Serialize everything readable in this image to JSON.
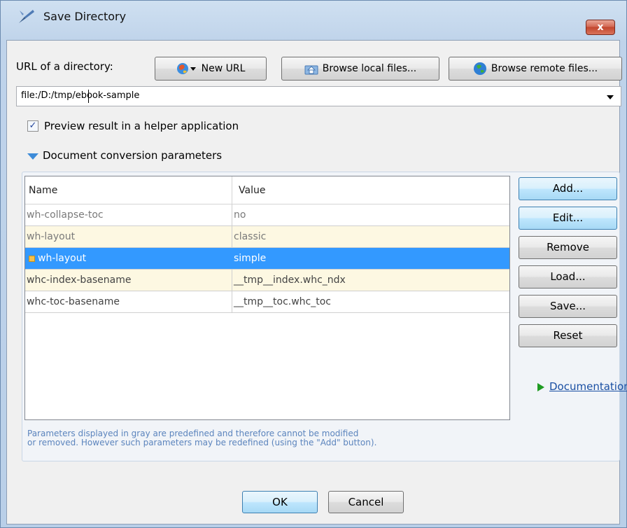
{
  "window": {
    "title": "Save Directory",
    "close_label": "x"
  },
  "url_section": {
    "label": "URL of a directory:",
    "new_url_label": "New URL",
    "browse_local_label": "Browse local files...",
    "browse_remote_label": "Browse remote files...",
    "url_value": "file:/D:/tmp/ebook-sample"
  },
  "preview": {
    "label": "Preview result in a helper application",
    "checked": true,
    "check_glyph": "✓"
  },
  "params_section": {
    "label": "Document conversion parameters",
    "columns": [
      "Name",
      "Value"
    ],
    "rows": [
      {
        "name": "wh-collapse-toc",
        "value": "no"
      },
      {
        "name": "wh-layout",
        "value": "classic"
      },
      {
        "name": "wh-layout",
        "value": "simple"
      },
      {
        "name": "whc-index-basename",
        "value": "__tmp__index.whc_ndx"
      },
      {
        "name": "whc-toc-basename",
        "value": "__tmp__toc.whc_toc"
      }
    ],
    "selected_row": 2,
    "buttons": {
      "add": "Add...",
      "edit": "Edit...",
      "remove": "Remove",
      "load": "Load...",
      "save": "Save...",
      "reset": "Reset"
    },
    "documentation_link": "Documentation",
    "hint_line1": "Parameters displayed in gray are predefined and therefore cannot be modified",
    "hint_line2": "or removed. However such parameters may be redefined (using the \"Add\" button)."
  },
  "footer": {
    "ok_label": "OK",
    "cancel_label": "Cancel"
  },
  "colors": {
    "selection": "#3399ff",
    "accent_link": "#1a4fa3",
    "override_row": "#fdf8e2"
  },
  "icons": {
    "app": "pen-nib-icon",
    "new_url": "globe-dropdown-icon",
    "browse_local": "folder-home-icon",
    "browse_remote": "globe-icon",
    "documentation": "play-arrow-icon"
  }
}
